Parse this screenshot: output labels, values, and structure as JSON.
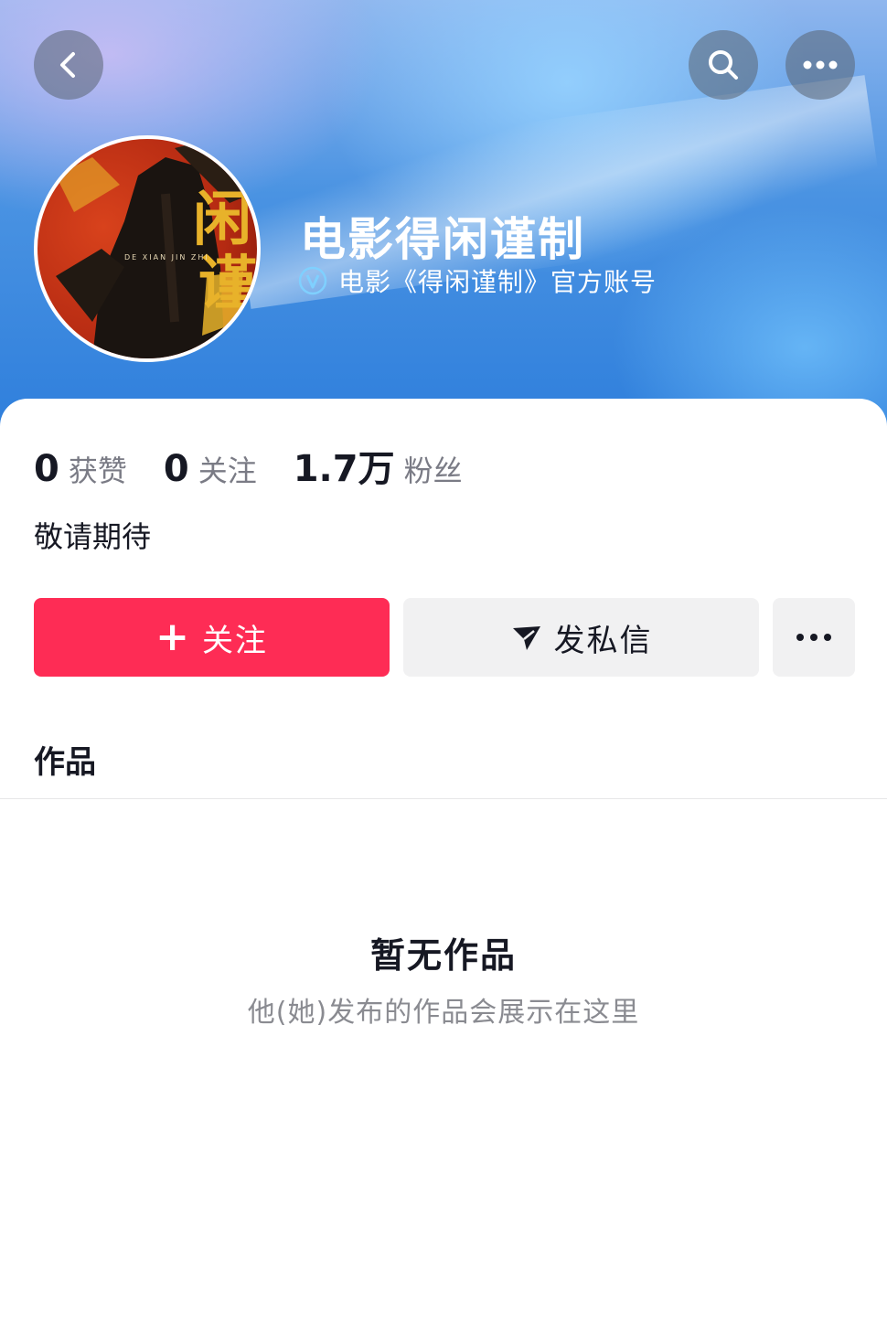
{
  "profile": {
    "name": "电影得闲谨制",
    "verified_description": "电影《得闲谨制》官方账号",
    "bio": "敬请期待",
    "avatar": {
      "title_characters": "闲谨",
      "romanized_text": "DE XIAN JIN ZHI"
    }
  },
  "stats": [
    {
      "value": "0",
      "label": "获赞"
    },
    {
      "value": "0",
      "label": "关注"
    },
    {
      "value": "1.7万",
      "label": "粉丝"
    }
  ],
  "actions": {
    "follow_label": "关注",
    "follow_icon": "plus-icon",
    "message_label": "发私信",
    "message_icon": "send-icon",
    "more_icon": "more-icon"
  },
  "nav": {
    "back_icon": "back-arrow-icon",
    "search_icon": "search-icon",
    "more_icon": "more-icon"
  },
  "tabs": {
    "works_label": "作品"
  },
  "empty_state": {
    "title": "暂无作品",
    "subtitle": "他(她)发布的作品会展示在这里"
  },
  "colors": {
    "accent": "#fe2c55",
    "secondary_button": "#f1f1f2",
    "header_blue": "#3a86de",
    "text_primary": "#161823",
    "text_secondary": "#8a8b91"
  }
}
